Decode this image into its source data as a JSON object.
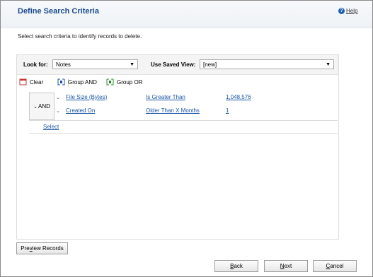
{
  "dialog": {
    "title": "Define Search Criteria",
    "help_label": "Help",
    "instruction": "Select search criteria to identify records to delete."
  },
  "criteria": {
    "look_for_label": "Look for:",
    "look_for_value": "Notes",
    "saved_view_label": "Use Saved View:",
    "saved_view_value": "[new]",
    "toolbar": {
      "clear": "Clear",
      "group_and": "Group AND",
      "group_or": "Group OR"
    },
    "group_operator": "AND",
    "conditions": [
      {
        "field": "File Size (Bytes)",
        "operator": "Is Greater Than",
        "value": "1,048,576"
      },
      {
        "field": "Created On",
        "operator": "Older Than X Months",
        "value": "1"
      }
    ],
    "select_link": "Select"
  },
  "buttons": {
    "preview": {
      "pre": "Pre",
      "accel": "v",
      "post": "iew Records"
    },
    "back": {
      "accel": "B",
      "post": "ack"
    },
    "next": {
      "accel": "N",
      "post": "ext"
    },
    "cancel": {
      "accel": "C",
      "post": "ancel"
    }
  },
  "colors": {
    "title": "#1c4a8e",
    "link": "#1a55a6",
    "help_icon": "#1e5fb3"
  }
}
